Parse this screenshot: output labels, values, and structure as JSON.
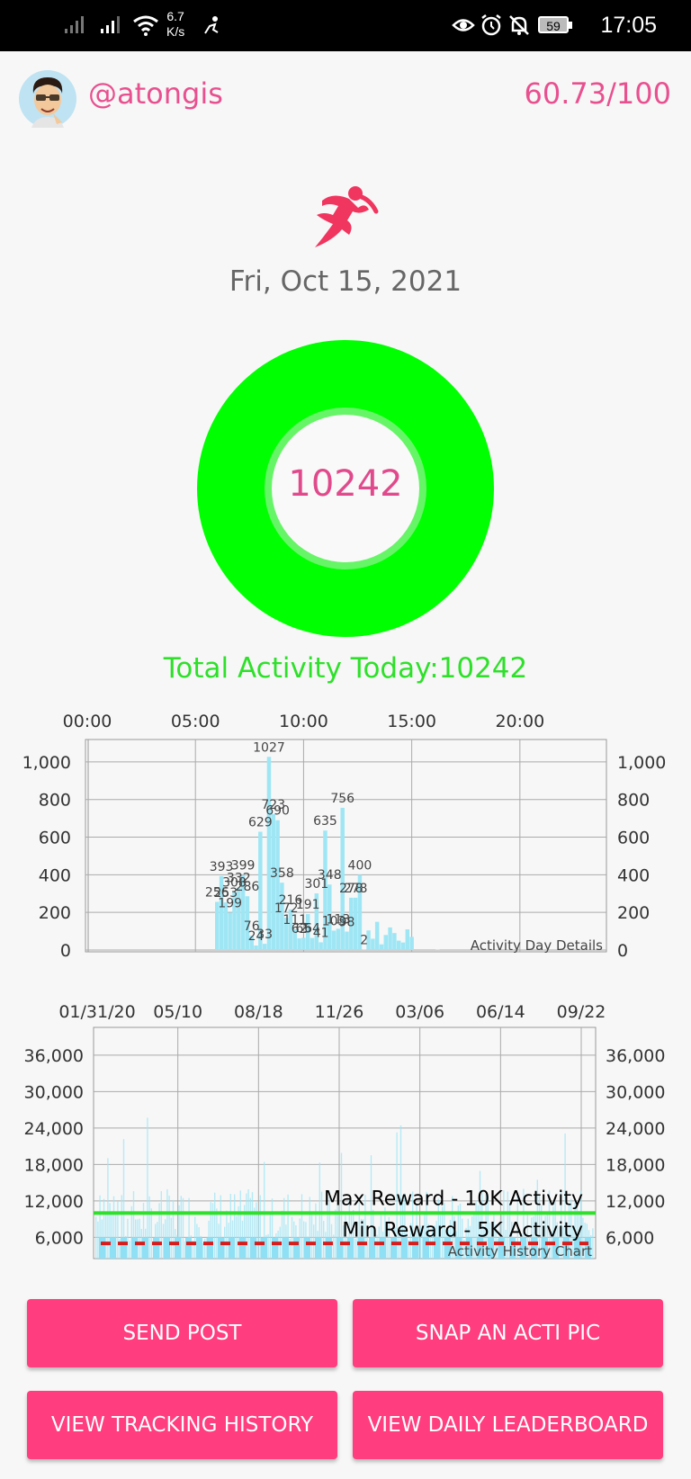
{
  "status_bar": {
    "speed_value": "6.7",
    "speed_unit": "K/s",
    "battery": "59",
    "time": "17:05"
  },
  "header": {
    "username": "@atongis",
    "score": "60.73/100"
  },
  "activity_icon": "runner-icon",
  "date": "Fri, Oct 15, 2021",
  "ring": {
    "value": "10242",
    "color": "#00ff00"
  },
  "total_label": "Total Activity Today:10242",
  "chart_data": [
    {
      "type": "bar",
      "caption": "Activity Day Details",
      "x_tick_labels": [
        "00:00",
        "05:00",
        "10:00",
        "15:00",
        "20:00"
      ],
      "x_unit": "hour",
      "xlim": [
        0,
        24
      ],
      "y_tick_labels": [
        "1,000",
        "800",
        "600",
        "400",
        "200",
        "0"
      ],
      "ylim": [
        0,
        1100
      ],
      "grid": true,
      "bar_color": "#9fe6f5",
      "x": [
        6.0,
        6.2,
        6.4,
        6.6,
        6.8,
        7.0,
        7.2,
        7.4,
        7.6,
        7.8,
        8.0,
        8.2,
        8.4,
        8.6,
        8.8,
        9.0,
        9.2,
        9.4,
        9.6,
        9.8,
        10.0,
        10.2,
        10.4,
        10.6,
        10.8,
        11.0,
        11.2,
        11.4,
        11.6,
        11.8,
        12.0,
        12.2,
        12.4,
        12.6,
        12.8,
        13.0,
        13.2,
        13.4,
        13.6,
        13.8,
        14.0,
        14.2,
        14.4,
        14.6,
        14.8,
        15.0,
        16.2
      ],
      "values": [
        256,
        393,
        253,
        199,
        308,
        332,
        399,
        286,
        76,
        24,
        629,
        33,
        1027,
        723,
        690,
        358,
        172,
        216,
        111,
        62,
        65,
        191,
        64,
        301,
        41,
        635,
        348,
        103,
        113,
        756,
        98,
        278,
        278,
        400,
        2,
        104,
        60,
        150,
        30,
        80,
        120,
        90,
        50,
        40,
        110,
        70,
        2
      ],
      "point_labels": [
        "256",
        "393",
        "253",
        "199",
        "308",
        "332",
        "399",
        "286",
        "76",
        "24",
        "629",
        "33",
        "1027",
        "723",
        "690",
        "358",
        "172",
        "216",
        "111",
        "62",
        "65",
        "191",
        "64",
        "301",
        "41",
        "635",
        "348",
        "103",
        "113",
        "756",
        "98",
        "278",
        "278",
        "400",
        "2"
      ]
    },
    {
      "type": "bar",
      "caption": "Activity History Chart",
      "x_tick_labels": [
        "01/31/20",
        "05/10",
        "08/18",
        "11/26",
        "03/06",
        "06/14",
        "09/22"
      ],
      "y_tick_labels": [
        "36,000",
        "30,000",
        "24,000",
        "18,000",
        "12,000",
        "6,000"
      ],
      "ylim": [
        2500,
        38500
      ],
      "grid": true,
      "bar_color": "#9fe6f5",
      "reference_lines": [
        {
          "label": "Max Reward - 10K Activity",
          "value": 10000,
          "color": "#2ee02a",
          "style": "solid"
        },
        {
          "label": "Min Reward - 5K Activity",
          "value": 5000,
          "color": "#d81b1b",
          "style": "dashed"
        }
      ]
    }
  ],
  "buttons": {
    "send_post": "SEND POST",
    "snap_pic": "SNAP AN ACTI PIC",
    "tracking_history": "VIEW TRACKING HISTORY",
    "daily_leaderboard": "VIEW DAILY LEADERBOARD"
  }
}
